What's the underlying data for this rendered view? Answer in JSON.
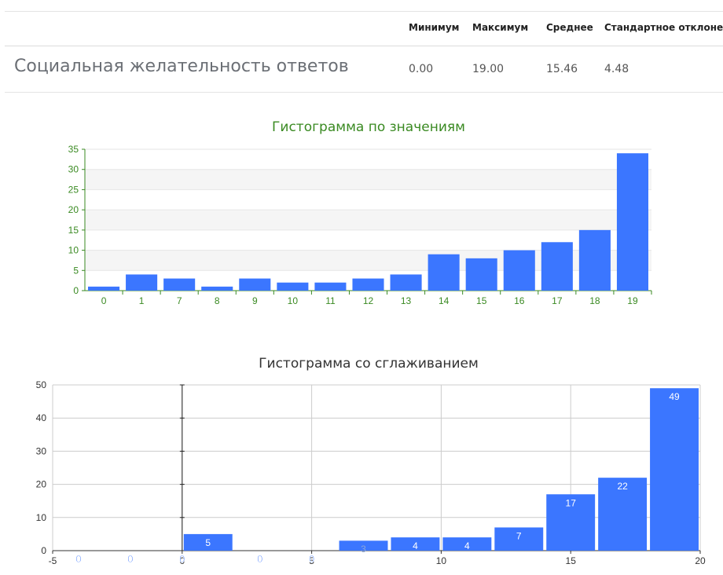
{
  "stats_table": {
    "headers": [
      "Минимум",
      "Максимум",
      "Среднее",
      "Стандартное отклонение"
    ],
    "row": {
      "name": "Социальная желательность ответов",
      "values": [
        "0.00",
        "19.00",
        "15.46",
        "4.48"
      ]
    }
  },
  "colors": {
    "bar": "#3b76ff",
    "chart1_axis": "#3a8a22",
    "chart1_title": "#3a8a22",
    "chart2_title": "#333333"
  },
  "chart_data": [
    {
      "type": "bar",
      "title": "Гистограмма по значениям",
      "categories": [
        "0",
        "1",
        "7",
        "8",
        "9",
        "10",
        "11",
        "12",
        "13",
        "14",
        "15",
        "16",
        "17",
        "18",
        "19"
      ],
      "values": [
        1,
        4,
        3,
        1,
        3,
        2,
        2,
        3,
        4,
        9,
        8,
        10,
        12,
        15,
        34
      ],
      "ylim": [
        0,
        35
      ],
      "yticks": [
        0,
        5,
        10,
        15,
        20,
        25,
        30,
        35
      ],
      "grid": true,
      "legend": "none"
    },
    {
      "type": "bar",
      "title": "Гистограмма со сглаживанием",
      "bins": [
        {
          "x0": -5,
          "x1": -3,
          "value": 0
        },
        {
          "x0": -3,
          "x1": -1,
          "value": 0
        },
        {
          "x0": -1,
          "x1": 1,
          "value": 0
        },
        {
          "x0": 0,
          "x1": 2,
          "value": 5
        },
        {
          "x0": 2,
          "x1": 4,
          "value": 0
        },
        {
          "x0": 4,
          "x1": 6,
          "value": 0
        },
        {
          "x0": 6,
          "x1": 8,
          "value": 3
        },
        {
          "x0": 8,
          "x1": 10,
          "value": 4
        },
        {
          "x0": 10,
          "x1": 12,
          "value": 4
        },
        {
          "x0": 12,
          "x1": 14,
          "value": 7
        },
        {
          "x0": 14,
          "x1": 16,
          "value": 17
        },
        {
          "x0": 16,
          "x1": 18,
          "value": 22
        },
        {
          "x0": 18,
          "x1": 20,
          "value": 49
        }
      ],
      "xlim": [
        -5,
        20
      ],
      "xticks": [
        -5,
        0,
        5,
        10,
        15,
        20
      ],
      "ylim": [
        0,
        50
      ],
      "yticks": [
        0,
        10,
        20,
        30,
        40,
        50
      ],
      "grid": true,
      "data_labels": true,
      "legend": "none"
    }
  ]
}
